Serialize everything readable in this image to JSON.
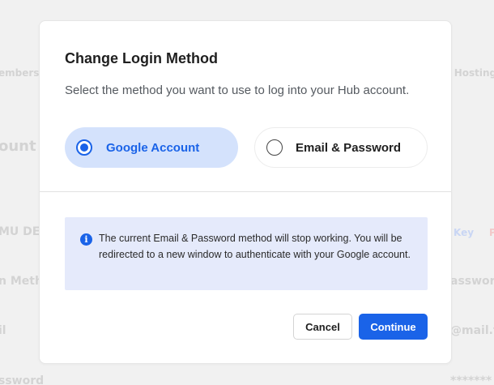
{
  "background": {
    "membership": "embership",
    "hosting": "n Hosting",
    "account": "ount D",
    "dev": "MU DEV",
    "key": "Key",
    "p": "P",
    "method": "n Metho",
    "password": "assword",
    "l": "il",
    "mail": "@mail.tl",
    "sword": "ssword",
    "stars": "*******"
  },
  "modal": {
    "title": "Change Login Method",
    "subtitle": "Select the method you want to use to log into your Hub account.",
    "options": [
      {
        "label": "Google Account",
        "selected": true
      },
      {
        "label": "Email & Password",
        "selected": false
      }
    ],
    "notice": {
      "icon": "info-icon",
      "text": "The current Email & Password method will stop working. You will be redirected to a new window to authenticate with your Google account."
    },
    "buttons": {
      "cancel": "Cancel",
      "continue": "Continue"
    }
  },
  "colors": {
    "accent": "#1a63e8",
    "selected_option_bg": "#d4e2fc",
    "notice_bg": "#e5eafb"
  }
}
